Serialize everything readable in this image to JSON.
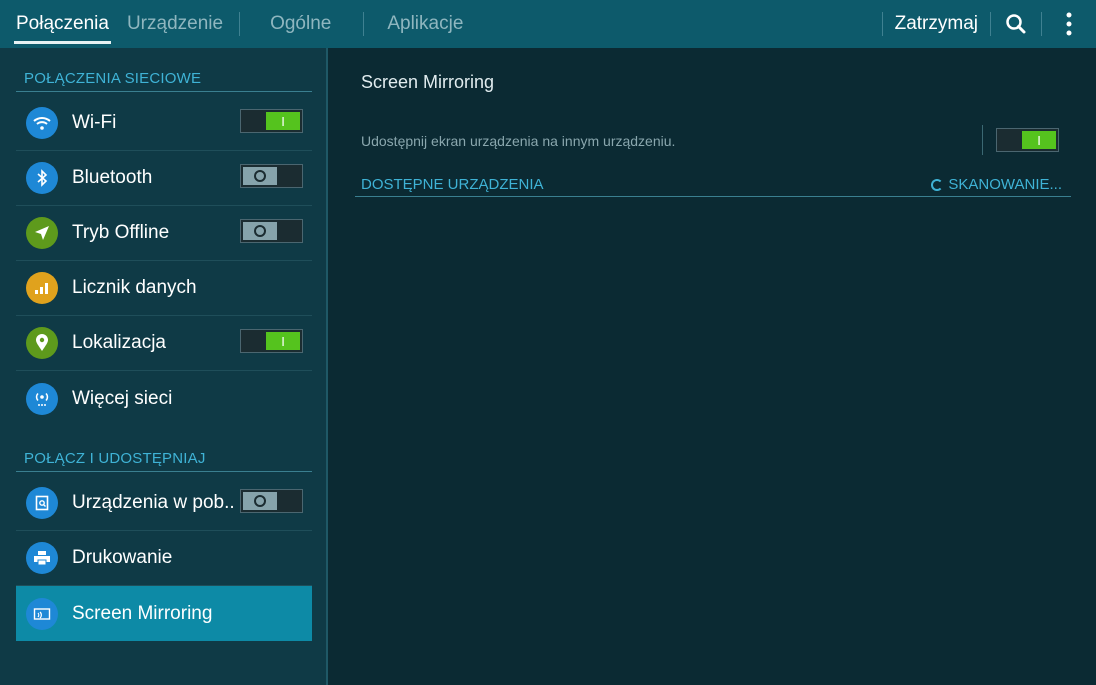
{
  "tabs": [
    {
      "label": "Połączenia",
      "active": true
    },
    {
      "label": "Urządzenie",
      "active": false
    },
    {
      "label": "Ogólne",
      "active": false
    },
    {
      "label": "Aplikacje",
      "active": false
    }
  ],
  "topbar": {
    "stop_label": "Zatrzymaj",
    "search_icon": "search-icon",
    "menu_icon": "overflow-menu-icon"
  },
  "sidebar": {
    "sections": [
      {
        "title": "POŁĄCZENIA SIECIOWE"
      },
      {
        "title": "POŁĄCZ I UDOSTĘPNIAJ"
      }
    ],
    "items": [
      {
        "label": "Wi-Fi",
        "icon": "wifi-icon",
        "icon_color": "#1e88d6",
        "toggle": "on"
      },
      {
        "label": "Bluetooth",
        "icon": "bluetooth-icon",
        "icon_color": "#1e88d6",
        "toggle": "off"
      },
      {
        "label": "Tryb Offline",
        "icon": "airplane-icon",
        "icon_color": "#5e9a1c",
        "toggle": "off"
      },
      {
        "label": "Licznik danych",
        "icon": "data-usage-icon",
        "icon_color": "#e0a21d",
        "toggle": null
      },
      {
        "label": "Lokalizacja",
        "icon": "location-icon",
        "icon_color": "#5e9a1c",
        "toggle": "on"
      },
      {
        "label": "Więcej sieci",
        "icon": "more-networks-icon",
        "icon_color": "#1e88d6",
        "toggle": null
      },
      {
        "label": "Urządzenia w pob..",
        "icon": "nearby-devices-icon",
        "icon_color": "#1e88d6",
        "toggle": "off"
      },
      {
        "label": "Drukowanie",
        "icon": "printer-icon",
        "icon_color": "#1e88d6",
        "toggle": null
      },
      {
        "label": "Screen Mirroring",
        "icon": "screen-mirroring-icon",
        "icon_color": "#1e88d6",
        "toggle": null,
        "selected": true
      }
    ]
  },
  "detail": {
    "title": "Screen Mirroring",
    "description": "Udostępnij ekran urządzenia na innym urządzeniu.",
    "toggle": "on",
    "available_header": "DOSTĘPNE URZĄDZENIA",
    "scanning_label": "SKANOWANIE..."
  },
  "colors": {
    "topbar": "#0d5a6b",
    "left_panel": "#0f3a46",
    "right_panel": "#0b2a33",
    "accent": "#3fb3d6",
    "selected": "#0d8aa6",
    "toggle_on": "#55c31e"
  }
}
